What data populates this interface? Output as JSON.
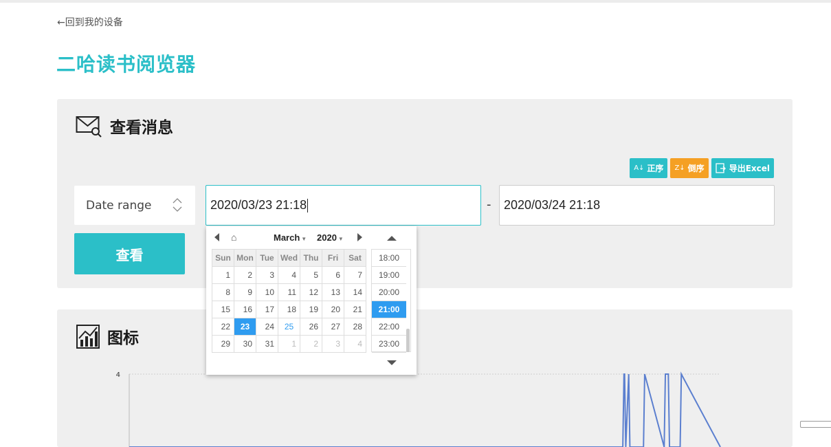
{
  "header": {
    "back_link": "←回到我的设备",
    "app_title": "二哈读书阅览器"
  },
  "messages_panel": {
    "title": "查看消息",
    "sort_asc_label": "正序",
    "sort_desc_label": "倒序",
    "export_label": "导出Excel",
    "range_select_value": "Date range",
    "date_start_value": "2020/03/23 21:18",
    "date_separator": "-",
    "date_end_value": "2020/03/24 21:18",
    "view_button_label": "查看"
  },
  "chart_panel": {
    "title": "图标"
  },
  "date_picker": {
    "month": "March",
    "year": "2020",
    "weekdays": [
      "Sun",
      "Mon",
      "Tue",
      "Wed",
      "Thu",
      "Fri",
      "Sat"
    ],
    "weeks": [
      [
        "1",
        "2",
        "3",
        "4",
        "5",
        "6",
        "7"
      ],
      [
        "8",
        "9",
        "10",
        "11",
        "12",
        "13",
        "14"
      ],
      [
        "15",
        "16",
        "17",
        "18",
        "19",
        "20",
        "21"
      ],
      [
        "22",
        "23",
        "24",
        "25",
        "26",
        "27",
        "28"
      ],
      [
        "29",
        "30",
        "31",
        "1",
        "2",
        "3",
        "4"
      ]
    ],
    "selected_day": "23",
    "today_day": "25",
    "times": [
      "18:00",
      "19:00",
      "20:00",
      "21:00",
      "22:00",
      "23:00"
    ],
    "selected_time": "21:00"
  },
  "chart_data": {
    "type": "line",
    "title": "",
    "xlabel": "",
    "ylabel": "",
    "y_ticks": [
      "4"
    ],
    "ylim": [
      0,
      4
    ],
    "series": [
      {
        "x": [
          0.0,
          0.835,
          0.837,
          0.838,
          0.84,
          0.845,
          0.847,
          0.87,
          0.872,
          0.905,
          0.907,
          0.912,
          0.914,
          0.932,
          0.934,
          1.0
        ],
        "values": [
          0,
          0,
          4,
          4,
          0,
          4,
          0,
          0,
          4,
          0,
          4,
          4,
          0,
          0,
          4,
          0
        ]
      }
    ],
    "colors": {
      "line": "#5b7fcf",
      "grid": "#cccccc"
    }
  },
  "colors": {
    "accent": "#2bbfc8",
    "orange": "#f5a024",
    "selected_blue": "#2f9cf0",
    "panel_bg": "#efefef"
  }
}
